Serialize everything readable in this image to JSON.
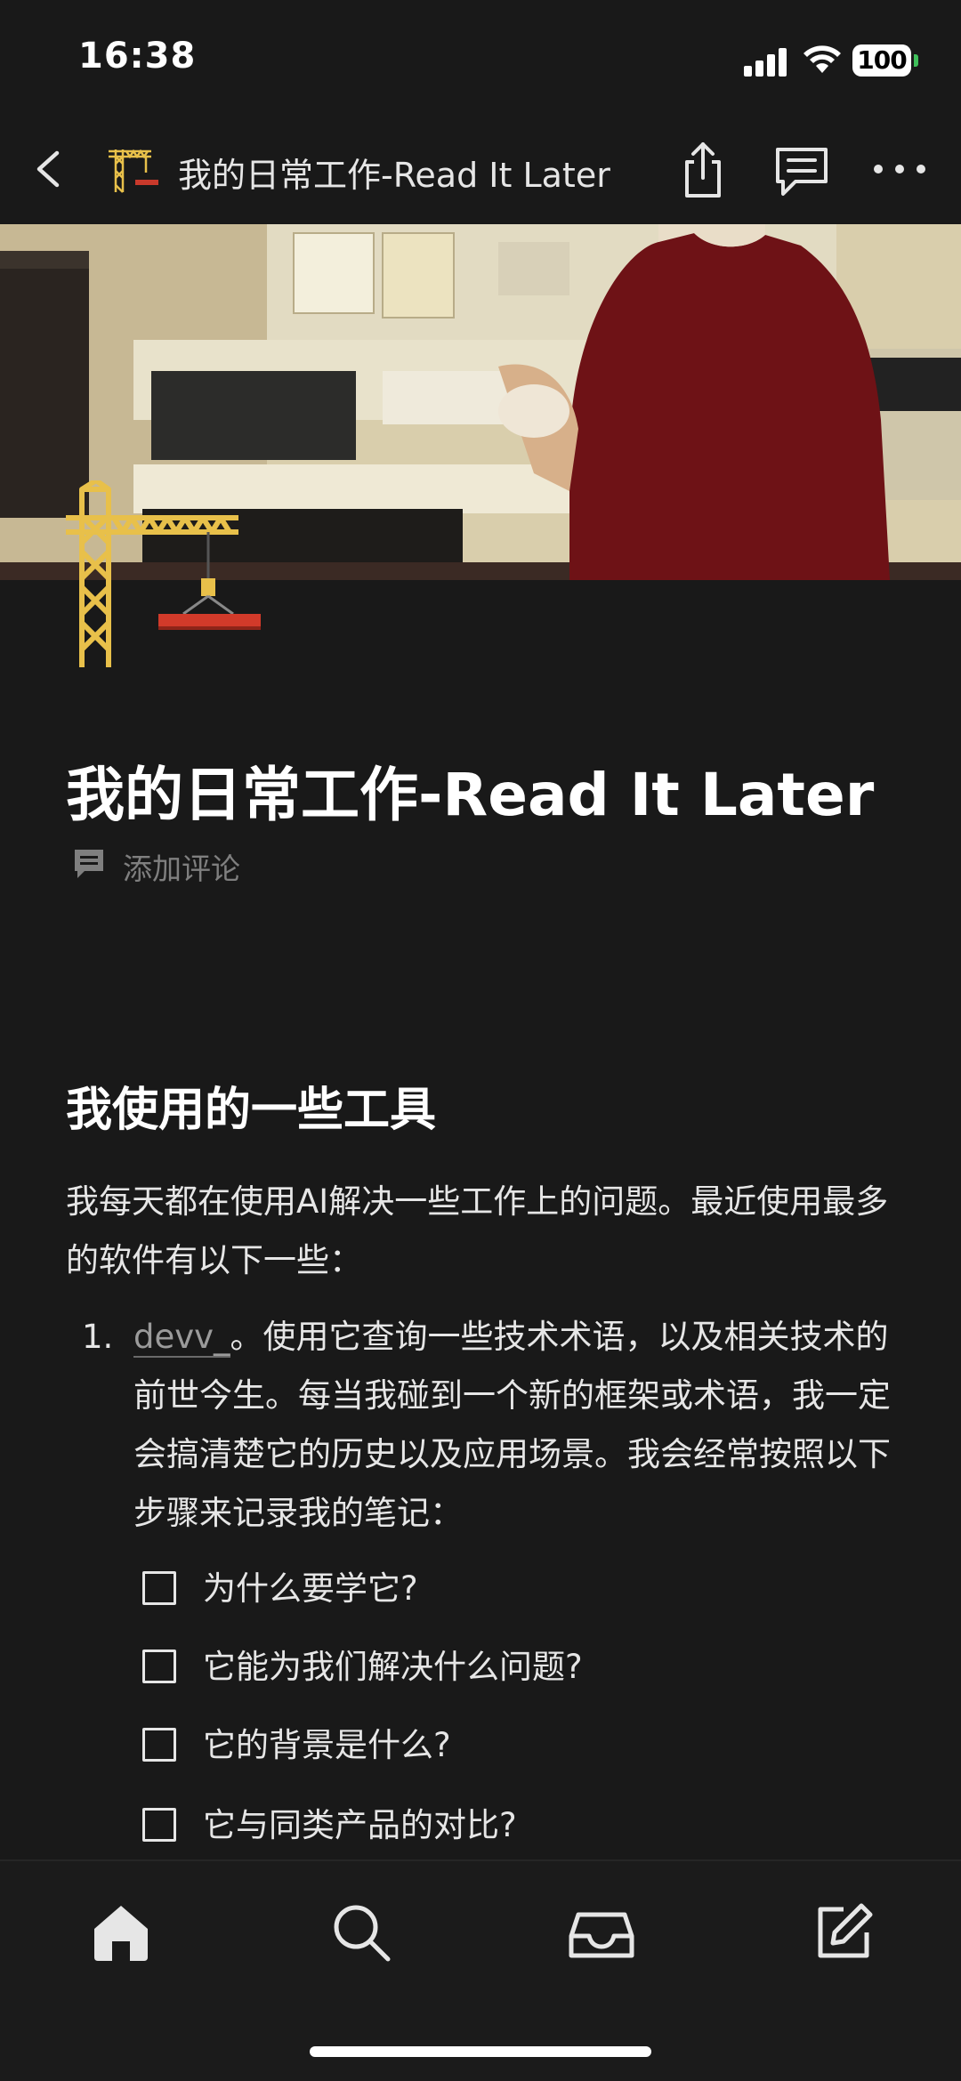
{
  "status_bar": {
    "time": "16:38",
    "battery": "100"
  },
  "nav": {
    "title": "我的日常工作-Read It Later",
    "icons": [
      "back-icon",
      "crane-icon",
      "share-icon",
      "comments-icon",
      "more-icon"
    ]
  },
  "page": {
    "title": "我的日常工作-Read It Later",
    "add_comment": "添加评论",
    "heading": "我使用的一些工具",
    "intro": "我每天都在使用AI解决一些工作上的问题。最近使用最多的软件有以下一些：",
    "list": [
      {
        "number": "1.",
        "link": "devv_",
        "text": "。使用它查询一些技术术语，以及相关技术的前世今生。每当我碰到一个新的框架或术语，我一定会搞清楚它的历史以及应用场景。我会经常按照以下步骤来记录我的笔记：",
        "todos": [
          {
            "label": "为什么要学它?",
            "checked": false
          },
          {
            "label": "它能为我们解决什么问题?",
            "checked": false
          },
          {
            "label": "它的背景是什么?",
            "checked": false
          },
          {
            "label": "它与同类产品的对比?",
            "checked": false
          }
        ]
      }
    ]
  },
  "tab_bar": {
    "tabs": [
      "home-icon",
      "search-icon",
      "inbox-icon",
      "compose-icon"
    ]
  },
  "colors": {
    "background": "#191919",
    "text": "#e6e6e6",
    "muted": "#7f7f7f",
    "crane": "#e8c04a",
    "beam": "#c8392b"
  }
}
